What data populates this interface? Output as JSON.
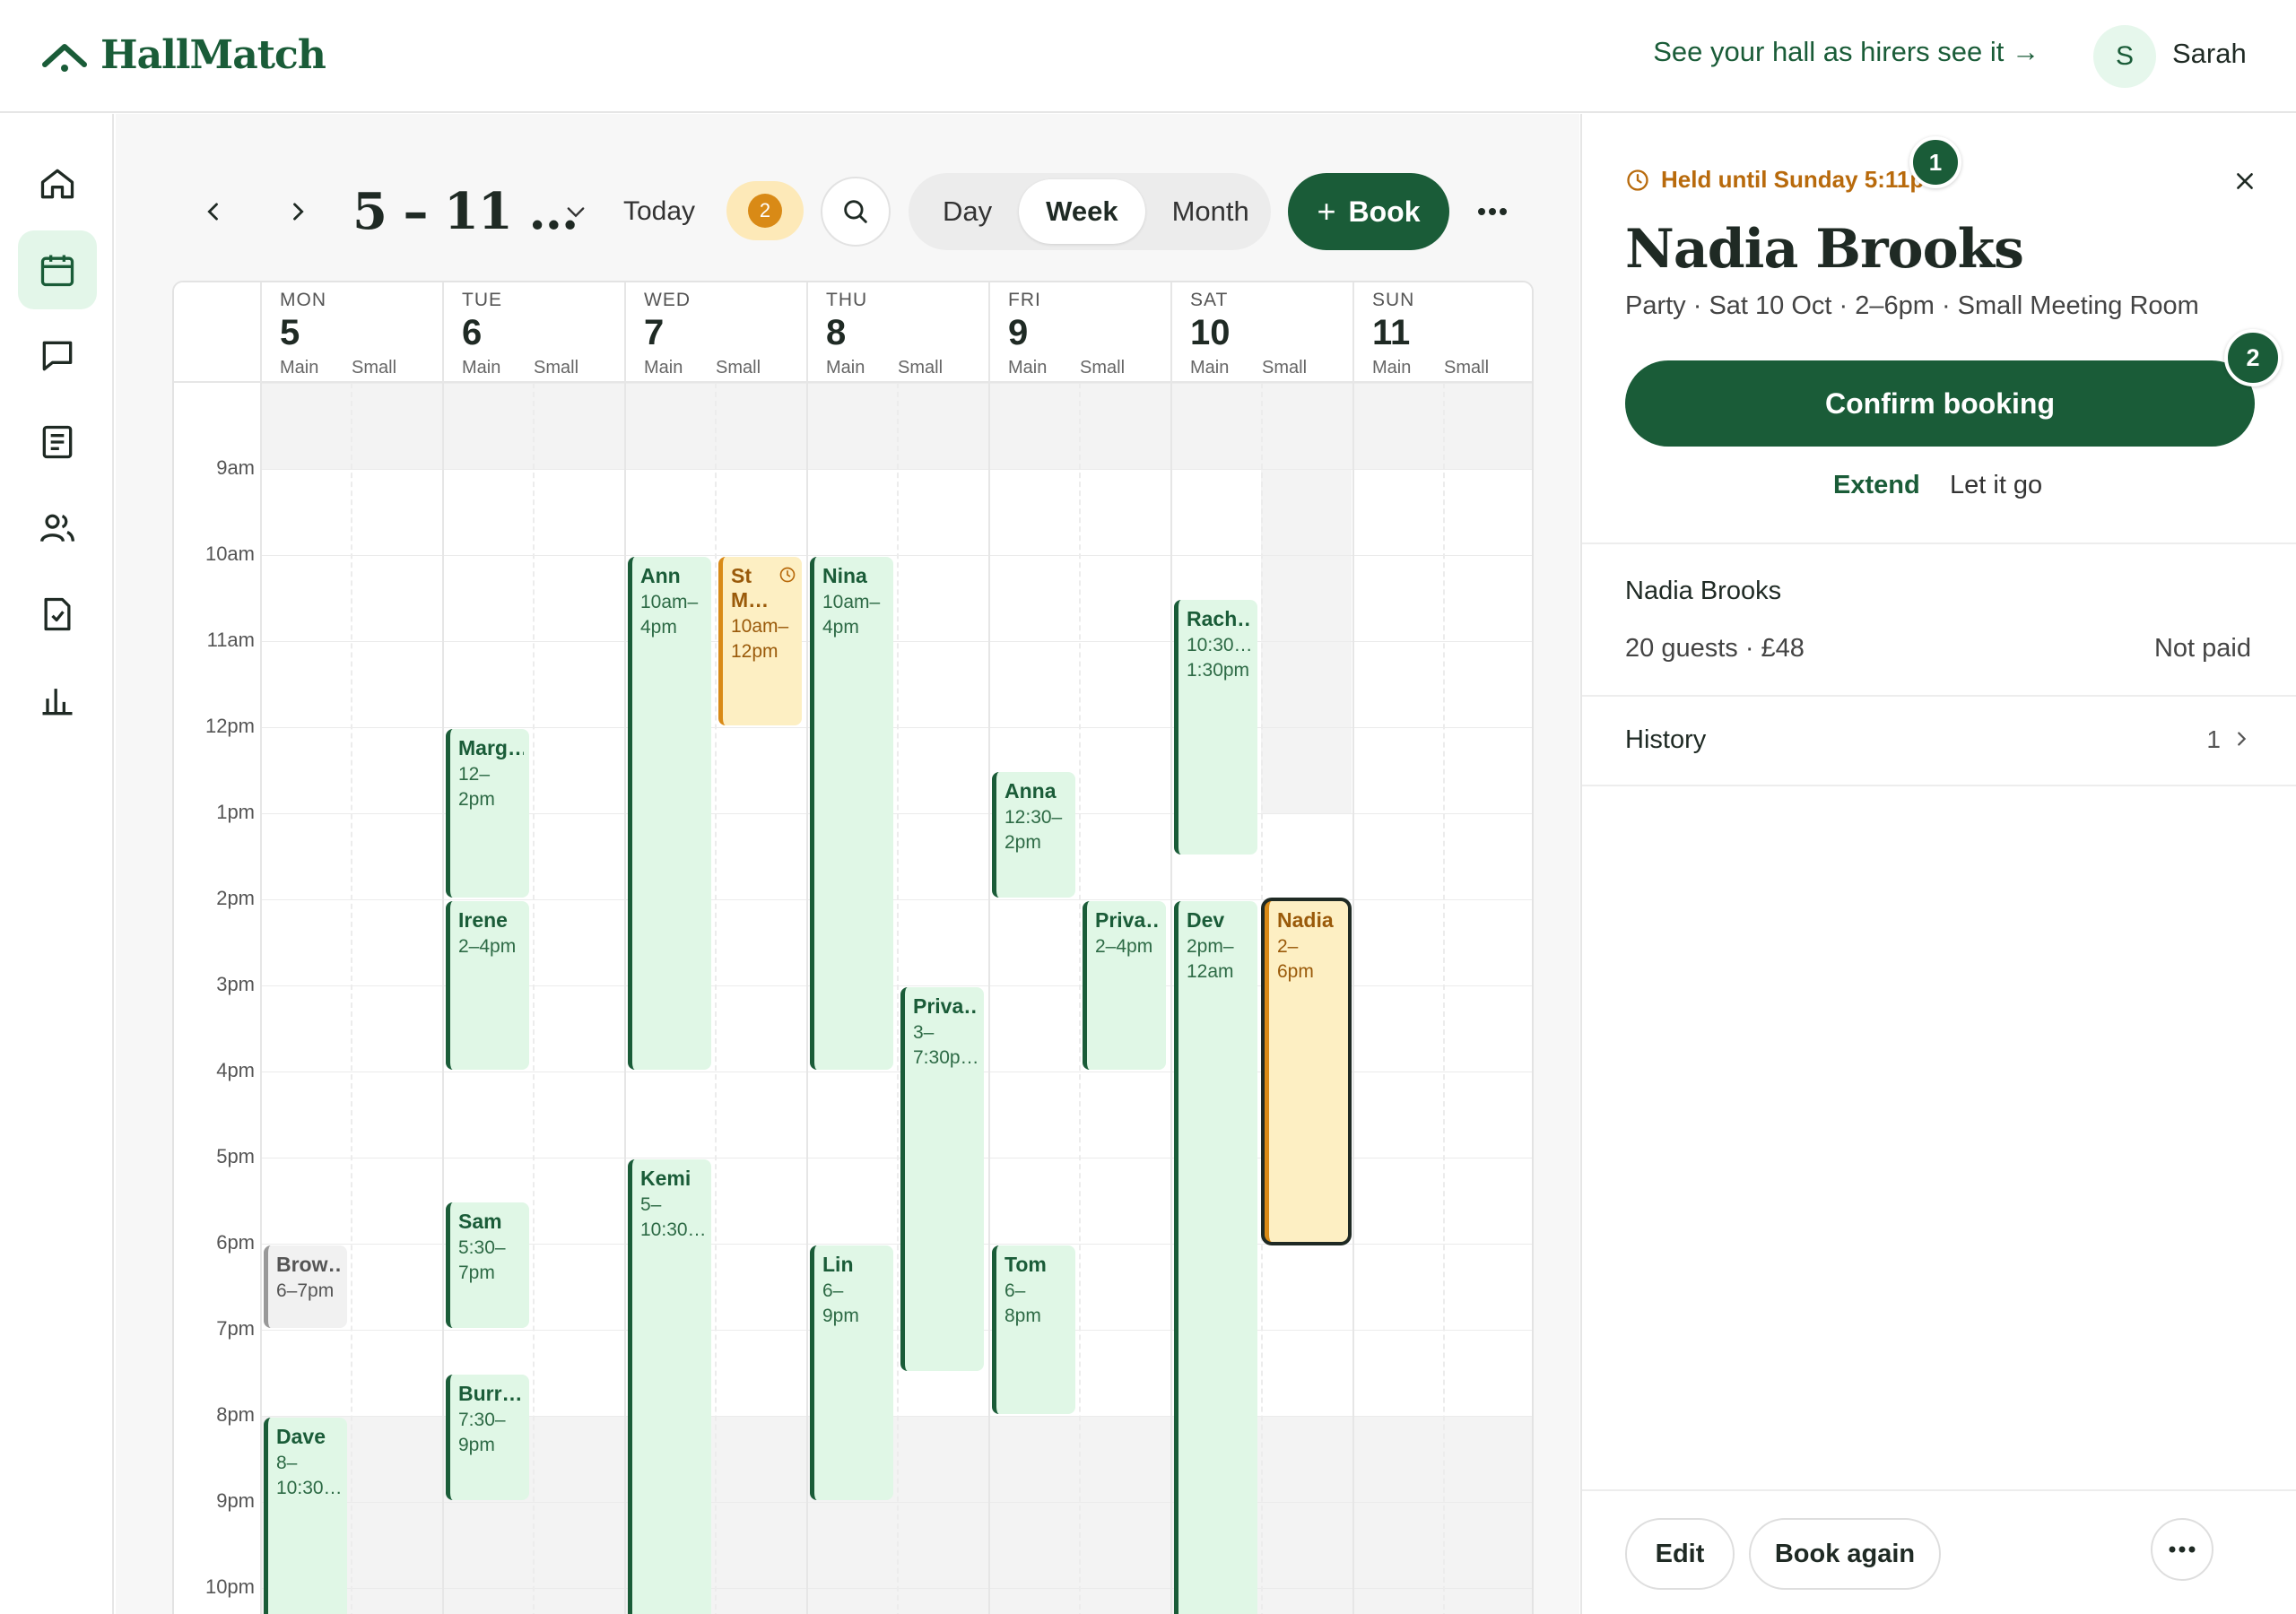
{
  "app": {
    "brand": "HallMatch"
  },
  "header": {
    "preview_link": "See your hall as hirers see it →",
    "user_initial": "S",
    "user_name": "Sarah"
  },
  "rail": {
    "items": [
      "home-icon",
      "calendar-icon",
      "messages-icon",
      "document-icon",
      "people-icon",
      "checklist-icon",
      "chart-icon"
    ],
    "active": "calendar-icon"
  },
  "toolbar": {
    "range_title": "5 – 11 …",
    "today_label": "Today",
    "held_count": "2",
    "views": [
      "Day",
      "Week",
      "Month"
    ],
    "active_view": "Week",
    "book_label": "Book",
    "book_icon": "+"
  },
  "calendar": {
    "days": [
      {
        "dow": "MON",
        "num": "5"
      },
      {
        "dow": "TUE",
        "num": "6"
      },
      {
        "dow": "WED",
        "num": "7"
      },
      {
        "dow": "THU",
        "num": "8"
      },
      {
        "dow": "FRI",
        "num": "9"
      },
      {
        "dow": "SAT",
        "num": "10"
      },
      {
        "dow": "SUN",
        "num": "11"
      }
    ],
    "rooms": [
      "Main",
      "Small"
    ],
    "times": [
      "9am",
      "10am",
      "11am",
      "12pm",
      "1pm",
      "2pm",
      "3pm",
      "4pm",
      "5pm",
      "6pm",
      "7pm",
      "8pm",
      "9pm",
      "10pm"
    ],
    "bookings": [
      {
        "day": 0,
        "room": 0,
        "name": "Brow…",
        "time": "6–7pm",
        "start": 18,
        "end": 19,
        "status": "tentative"
      },
      {
        "day": 0,
        "room": 0,
        "name": "Dave",
        "time": "8–\n10:30…",
        "start": 20,
        "end": 22.5,
        "status": "confirmed"
      },
      {
        "day": 1,
        "room": 0,
        "name": "Marg…",
        "time": "12–\n2pm",
        "start": 12,
        "end": 14,
        "status": "confirmed"
      },
      {
        "day": 1,
        "room": 0,
        "name": "Irene",
        "time": "2–4pm",
        "start": 14,
        "end": 16,
        "status": "confirmed"
      },
      {
        "day": 1,
        "room": 0,
        "name": "Sam",
        "time": "5:30–\n7pm",
        "start": 17.5,
        "end": 19,
        "status": "confirmed"
      },
      {
        "day": 1,
        "room": 0,
        "name": "Burr…",
        "time": "7:30–\n9pm",
        "start": 19.5,
        "end": 21,
        "status": "confirmed"
      },
      {
        "day": 2,
        "room": 0,
        "name": "Ann",
        "time": "10am–\n4pm",
        "start": 10,
        "end": 16,
        "status": "confirmed"
      },
      {
        "day": 2,
        "room": 1,
        "name": "St\nM…",
        "time": "10am–\n12pm",
        "start": 10,
        "end": 12,
        "status": "held"
      },
      {
        "day": 2,
        "room": 0,
        "name": "Kemi",
        "time": "5–\n10:30…",
        "start": 17,
        "end": 22.5,
        "status": "confirmed"
      },
      {
        "day": 3,
        "room": 0,
        "name": "Nina",
        "time": "10am–\n4pm",
        "start": 10,
        "end": 16,
        "status": "confirmed"
      },
      {
        "day": 3,
        "room": 1,
        "name": "Priva…",
        "time": "3–\n7:30p…",
        "start": 15,
        "end": 19.5,
        "status": "confirmed"
      },
      {
        "day": 3,
        "room": 0,
        "name": "Lin",
        "time": "6–\n9pm",
        "start": 18,
        "end": 21,
        "status": "confirmed"
      },
      {
        "day": 4,
        "room": 0,
        "name": "Anna",
        "time": "12:30–\n2pm",
        "start": 12.5,
        "end": 14,
        "status": "confirmed"
      },
      {
        "day": 4,
        "room": 1,
        "name": "Priva…",
        "time": "2–4pm",
        "start": 14,
        "end": 16,
        "status": "confirmed"
      },
      {
        "day": 4,
        "room": 0,
        "name": "Tom",
        "time": "6–\n8pm",
        "start": 18,
        "end": 20,
        "status": "confirmed"
      },
      {
        "day": 5,
        "room": 0,
        "name": "Rach…",
        "time": "10:30…\n1:30pm",
        "start": 10.5,
        "end": 13.5,
        "status": "confirmed"
      },
      {
        "day": 5,
        "room": 0,
        "name": "Dev",
        "time": "2pm–\n12am",
        "start": 14,
        "end": 24,
        "status": "confirmed"
      },
      {
        "day": 5,
        "room": 1,
        "name": "Nadia",
        "time": "2–\n6pm",
        "start": 14,
        "end": 18,
        "status": "selected"
      }
    ]
  },
  "panel": {
    "held_label": "Held until Sunday 5:11p",
    "hint_1": "1",
    "hint_2": "2",
    "title": "Nadia Brooks",
    "subtitle": "Party · Sat 10 Oct · 2–6pm · Small Meeting Room",
    "confirm_label": "Confirm booking",
    "extend_label": "Extend",
    "letgo_label": "Let it go",
    "hirer_name": "Nadia Brooks",
    "guests_price": "20 guests · £48",
    "payment_status": "Not paid",
    "history_label": "History",
    "history_count": "1",
    "edit_label": "Edit",
    "book_again_label": "Book again"
  },
  "colors": {
    "brand_green": "#1a5c38",
    "booking_fill": "#e0f7e6",
    "held_fill": "#fdefc3",
    "held_accent": "#d98a16"
  }
}
